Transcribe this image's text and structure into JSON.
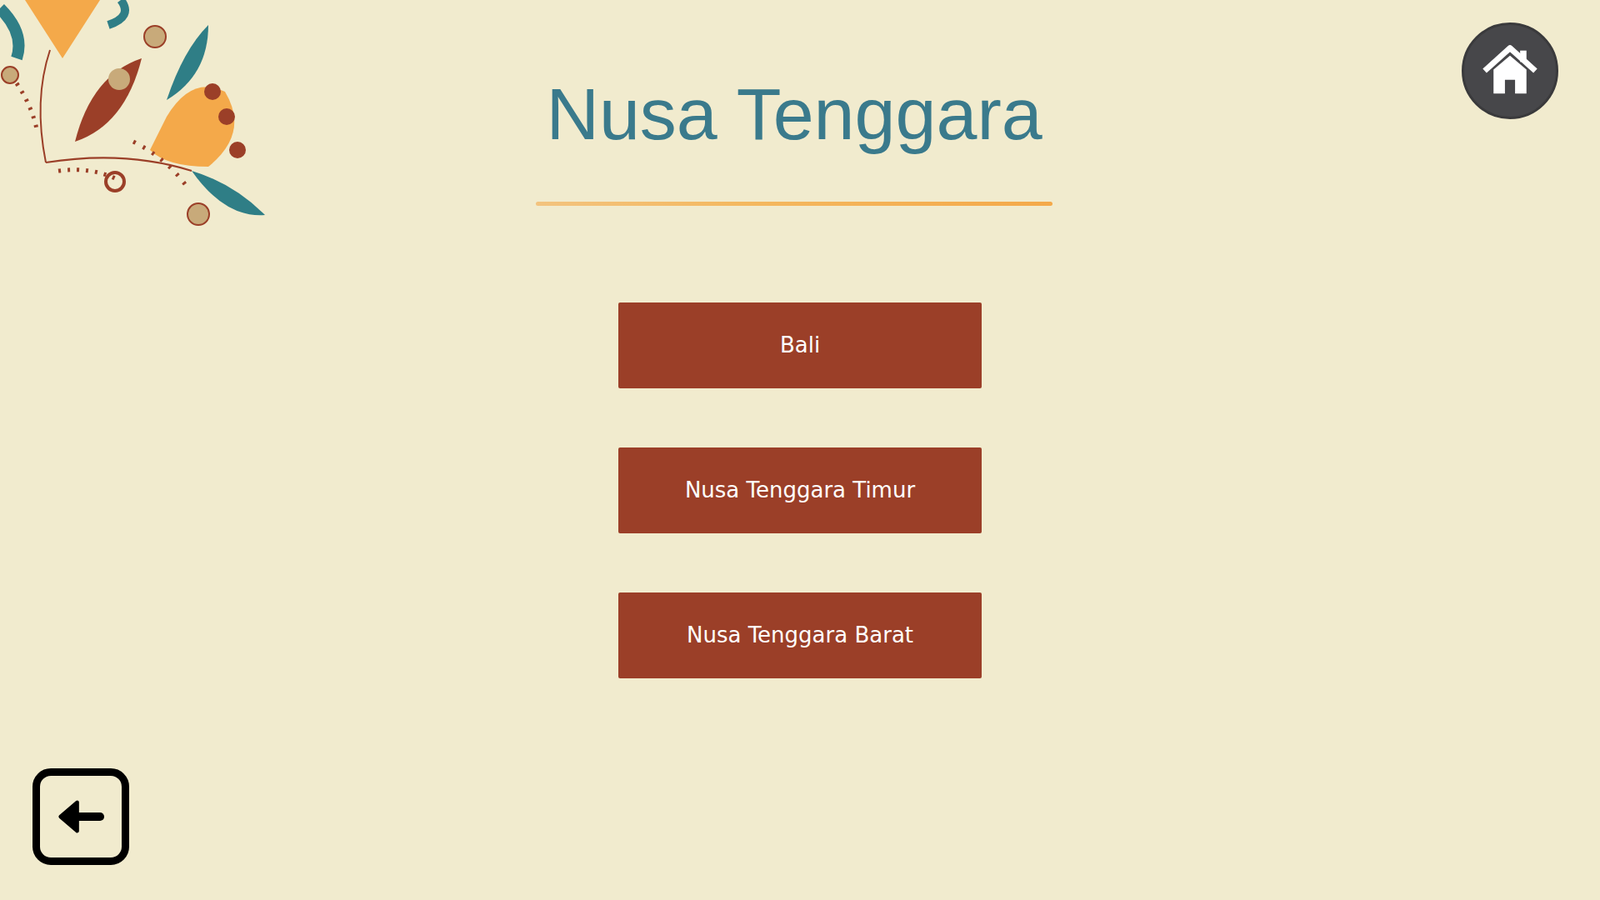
{
  "page": {
    "title": "Nusa Tenggara"
  },
  "regions": [
    {
      "label": "Bali"
    },
    {
      "label": "Nusa Tenggara Timur"
    },
    {
      "label": "Nusa Tenggara Barat"
    }
  ]
}
